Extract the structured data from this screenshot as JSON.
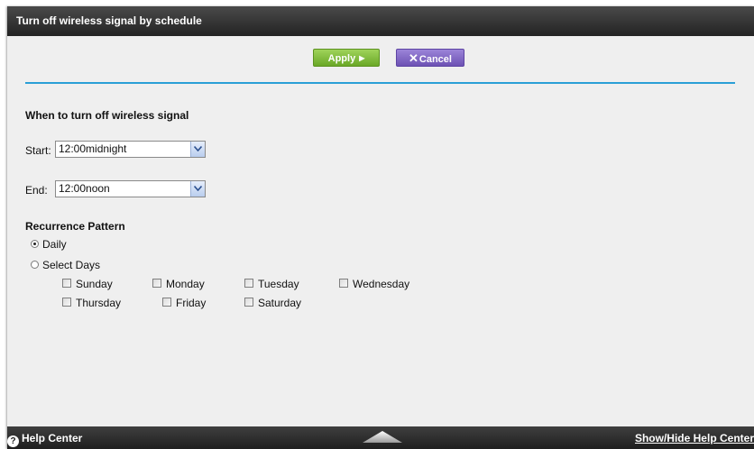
{
  "header": {
    "title": "Turn off wireless signal by schedule"
  },
  "actions": {
    "apply_label": "Apply",
    "cancel_label": "Cancel"
  },
  "schedule": {
    "heading": "When to turn off wireless signal",
    "start_label": "Start:",
    "start_value": "12:00midnight",
    "end_label": "End:",
    "end_value": "12:00noon"
  },
  "recurrence": {
    "heading": "Recurrence Pattern",
    "options": [
      {
        "label": "Daily",
        "checked": true
      },
      {
        "label": "Select Days",
        "checked": false
      }
    ],
    "days": [
      "Sunday",
      "Monday",
      "Tuesday",
      "Wednesday",
      "Thursday",
      "Friday",
      "Saturday"
    ]
  },
  "footer": {
    "help_label": "Help Center",
    "toggle_label": "Show/Hide Help Center"
  },
  "colors": {
    "accent_line": "#2a9fd6",
    "apply_button": "#7fbe3b",
    "cancel_button": "#7a60c4"
  }
}
